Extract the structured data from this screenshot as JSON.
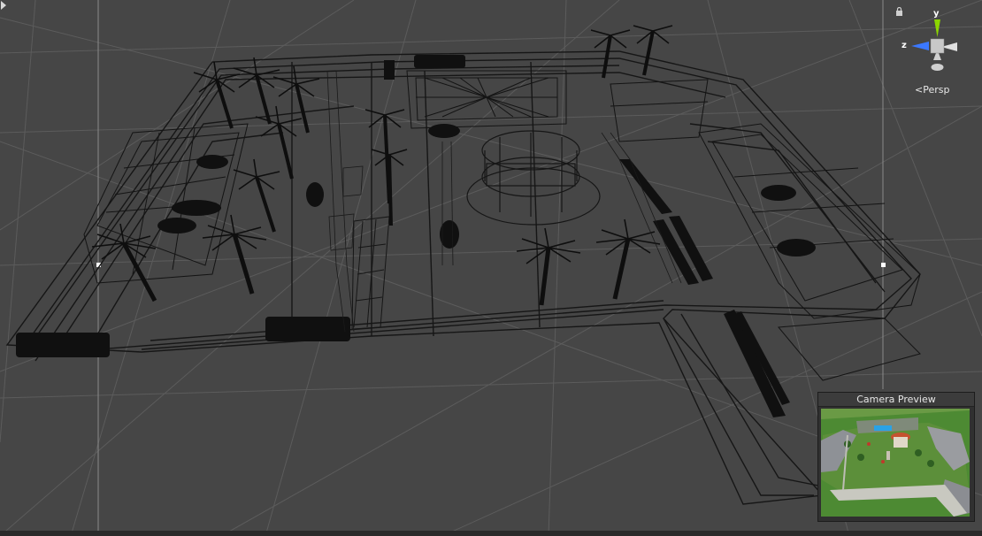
{
  "scene": {
    "view_mode": "Persp",
    "gizmo_axes": {
      "y": "y",
      "z": "z"
    },
    "gizmo_colors": {
      "y": "#8bd600",
      "z": "#3b78ff",
      "x": "#d8d8d8"
    },
    "background_color": "#464646",
    "wire_color": "#141414"
  },
  "camera_preview": {
    "title": "Camera Preview"
  }
}
